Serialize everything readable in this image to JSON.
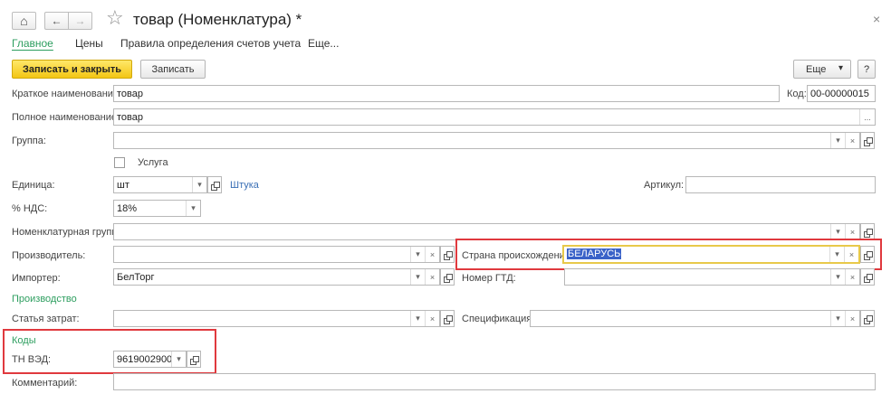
{
  "window": {
    "title": "товар (Номенклатура) *"
  },
  "tabs": [
    "Главное",
    "Цены",
    "Правила определения счетов учета",
    "Еще..."
  ],
  "toolbar": {
    "save_close": "Записать и закрыть",
    "save": "Записать",
    "more": "Еще",
    "help": "?"
  },
  "form": {
    "short_name_label": "Краткое наименование:",
    "short_name_value": "товар",
    "code_label": "Код:",
    "code_value": "00-00000015",
    "full_name_label": "Полное наименование:",
    "full_name_value": "товар",
    "full_name_ellipsis": "...",
    "group_label": "Группа:",
    "group_value": "",
    "service_label": "Услуга",
    "service_checked": false,
    "unit_label": "Единица:",
    "unit_value": "шт",
    "unit_link": "Штука",
    "article_label": "Артикул:",
    "article_value": "",
    "vat_label": "% НДС:",
    "vat_value": "18%",
    "nom_group_label": "Номенклатурная группа:",
    "nom_group_value": "",
    "producer_label": "Производитель:",
    "producer_value": "",
    "country_label": "Страна происхождения:",
    "country_value": "БЕЛАРУСЬ",
    "importer_label": "Импортер:",
    "importer_value": "БелТорг",
    "gtd_label": "Номер ГТД:",
    "gtd_value": "",
    "production_section": "Производство",
    "cost_item_label": "Статья затрат:",
    "cost_item_value": "",
    "spec_label": "Спецификация:",
    "spec_value": "",
    "codes_section": "Коды",
    "tn_ved_label": "ТН ВЭД:",
    "tn_ved_value": "9619002900",
    "comment_label": "Комментарий:",
    "comment_value": ""
  },
  "glyphs": {
    "dropdown": "▾",
    "clear": "×",
    "close": "×",
    "star": "☆",
    "home": "⌂",
    "back": "←",
    "forward": "→"
  },
  "colors": {
    "accent_green": "#2d9e5f",
    "primary_button": "#f3c614",
    "highlight_red": "#e0393e",
    "focus_border": "#e8c94a",
    "selection": "#3a62c8",
    "link": "#3a6fb5"
  }
}
